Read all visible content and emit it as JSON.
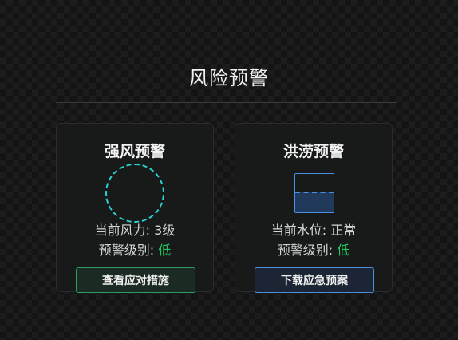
{
  "page": {
    "title": "风险预警"
  },
  "cards": {
    "wind": {
      "title": "强风预警",
      "current_label": "当前风力: ",
      "current_value": "3级",
      "level_label": "预警级别: ",
      "level_value": "低",
      "button_label": "查看应对措施",
      "icon": "wind-circle-icon",
      "accent_color": "#2bd0d0"
    },
    "flood": {
      "title": "洪涝预警",
      "current_label": "当前水位: ",
      "current_value": "正常",
      "level_label": "预警级别: ",
      "level_value": "低",
      "button_label": "下载应急预案",
      "icon": "water-level-icon",
      "water_level_fraction": 0.5,
      "accent_color": "#4a90e2"
    }
  },
  "colors": {
    "level_low": "#22c55e",
    "green_button_border": "#2e9a62",
    "blue_button_border": "#4a90e2"
  }
}
